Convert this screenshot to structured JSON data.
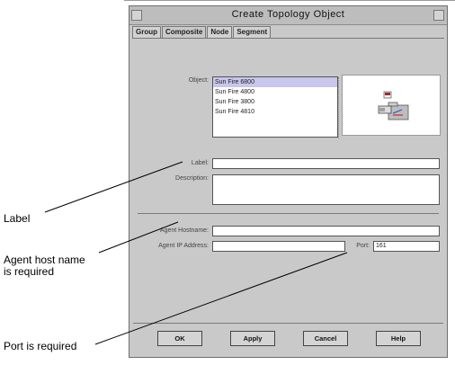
{
  "dialog": {
    "title": "Create Topology Object",
    "tabs": [
      "Group",
      "Composite",
      "Node",
      "Segment"
    ]
  },
  "object": {
    "label": "Object:",
    "items": [
      "Sun Fire 6800",
      "Sun Fire 4800",
      "Sun Fire 3800",
      "Sun Fire 4810"
    ],
    "selected_index": 0
  },
  "form": {
    "label_label": "Label:",
    "label_value": "",
    "description_label": "Description:",
    "description_value": "",
    "agent_hostname_label": "Agent Hostname:",
    "agent_hostname_value": "",
    "agent_ip_label": "Agent IP Address:",
    "agent_ip_value": "",
    "port_label": "Port:",
    "port_value": "161"
  },
  "buttons": {
    "ok": "OK",
    "apply": "Apply",
    "cancel": "Cancel",
    "help": "Help"
  },
  "callouts": {
    "label": "Label",
    "agent_host_line1": "Agent host name",
    "agent_host_line2": "is required",
    "port": "Port is required"
  }
}
